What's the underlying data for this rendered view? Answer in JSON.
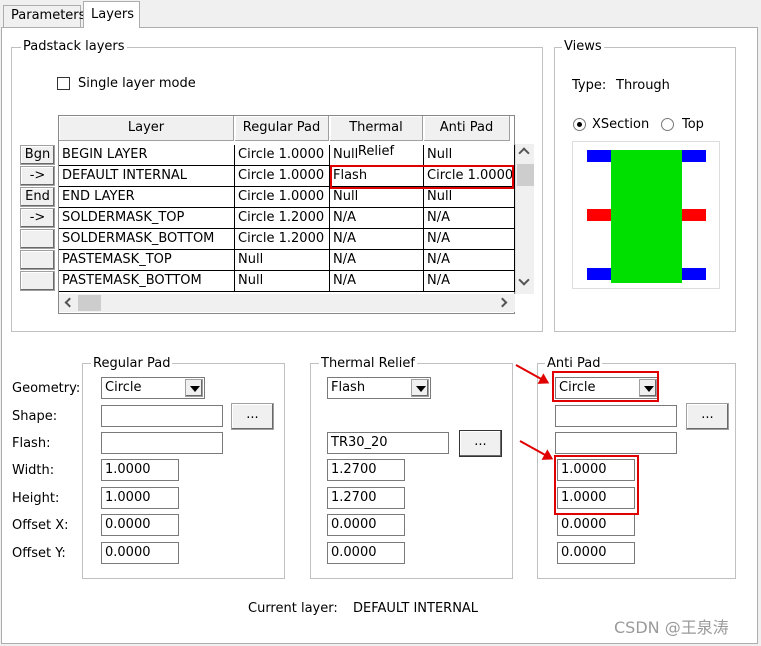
{
  "tabs": [
    "Parameters",
    "Layers"
  ],
  "padstack": {
    "title": "Padstack layers",
    "single_layer_mode": "Single layer mode",
    "columns": [
      "Layer",
      "Regular Pad",
      "Thermal Relief",
      "Anti Pad"
    ],
    "row_buttons": [
      "Bgn",
      "->",
      "End",
      "->",
      "",
      "",
      ""
    ],
    "rows": [
      [
        "BEGIN LAYER",
        "Circle 1.0000",
        "Null",
        "Null"
      ],
      [
        "DEFAULT INTERNAL",
        "Circle 1.0000",
        "Flash",
        "Circle 1.0000"
      ],
      [
        "END LAYER",
        "Circle 1.0000",
        "Null",
        "Null"
      ],
      [
        "SOLDERMASK_TOP",
        "Circle 1.2000",
        "N/A",
        "N/A"
      ],
      [
        "SOLDERMASK_BOTTOM",
        "Circle 1.2000",
        "N/A",
        "N/A"
      ],
      [
        "PASTEMASK_TOP",
        "Null",
        "N/A",
        "N/A"
      ],
      [
        "PASTEMASK_BOTTOM",
        "Null",
        "N/A",
        "N/A"
      ]
    ]
  },
  "views": {
    "title": "Views",
    "type_label": "Type:",
    "type_value": "Through",
    "xsection": "XSection",
    "top": "Top",
    "selected": "XSection"
  },
  "labels": {
    "geometry": "Geometry:",
    "shape": "Shape:",
    "flash": "Flash:",
    "width": "Width:",
    "height": "Height:",
    "offset_x": "Offset X:",
    "offset_y": "Offset Y:"
  },
  "regular_pad": {
    "title": "Regular Pad",
    "geometry": "Circle",
    "shape": "",
    "flash": "",
    "width": "1.0000",
    "height": "1.0000",
    "offset_x": "0.0000",
    "offset_y": "0.0000",
    "browse": "..."
  },
  "thermal_relief": {
    "title": "Thermal Relief",
    "geometry": "Flash",
    "flash": "TR30_20",
    "width": "1.2700",
    "height": "1.2700",
    "offset_x": "0.0000",
    "offset_y": "0.0000",
    "browse": "..."
  },
  "anti_pad": {
    "title": "Anti Pad",
    "geometry": "Circle",
    "shape": "",
    "flash": "",
    "width": "1.0000",
    "height": "1.0000",
    "offset_x": "0.0000",
    "offset_y": "0.0000",
    "browse": "..."
  },
  "current_layer": {
    "label": "Current layer:",
    "value": "DEFAULT INTERNAL"
  },
  "watermark": "CSDN @王泉涛",
  "colors": {
    "highlight": "#e00000",
    "pad": "#00e000",
    "layer_blue": "#0000ff",
    "layer_red": "#ff0000"
  }
}
